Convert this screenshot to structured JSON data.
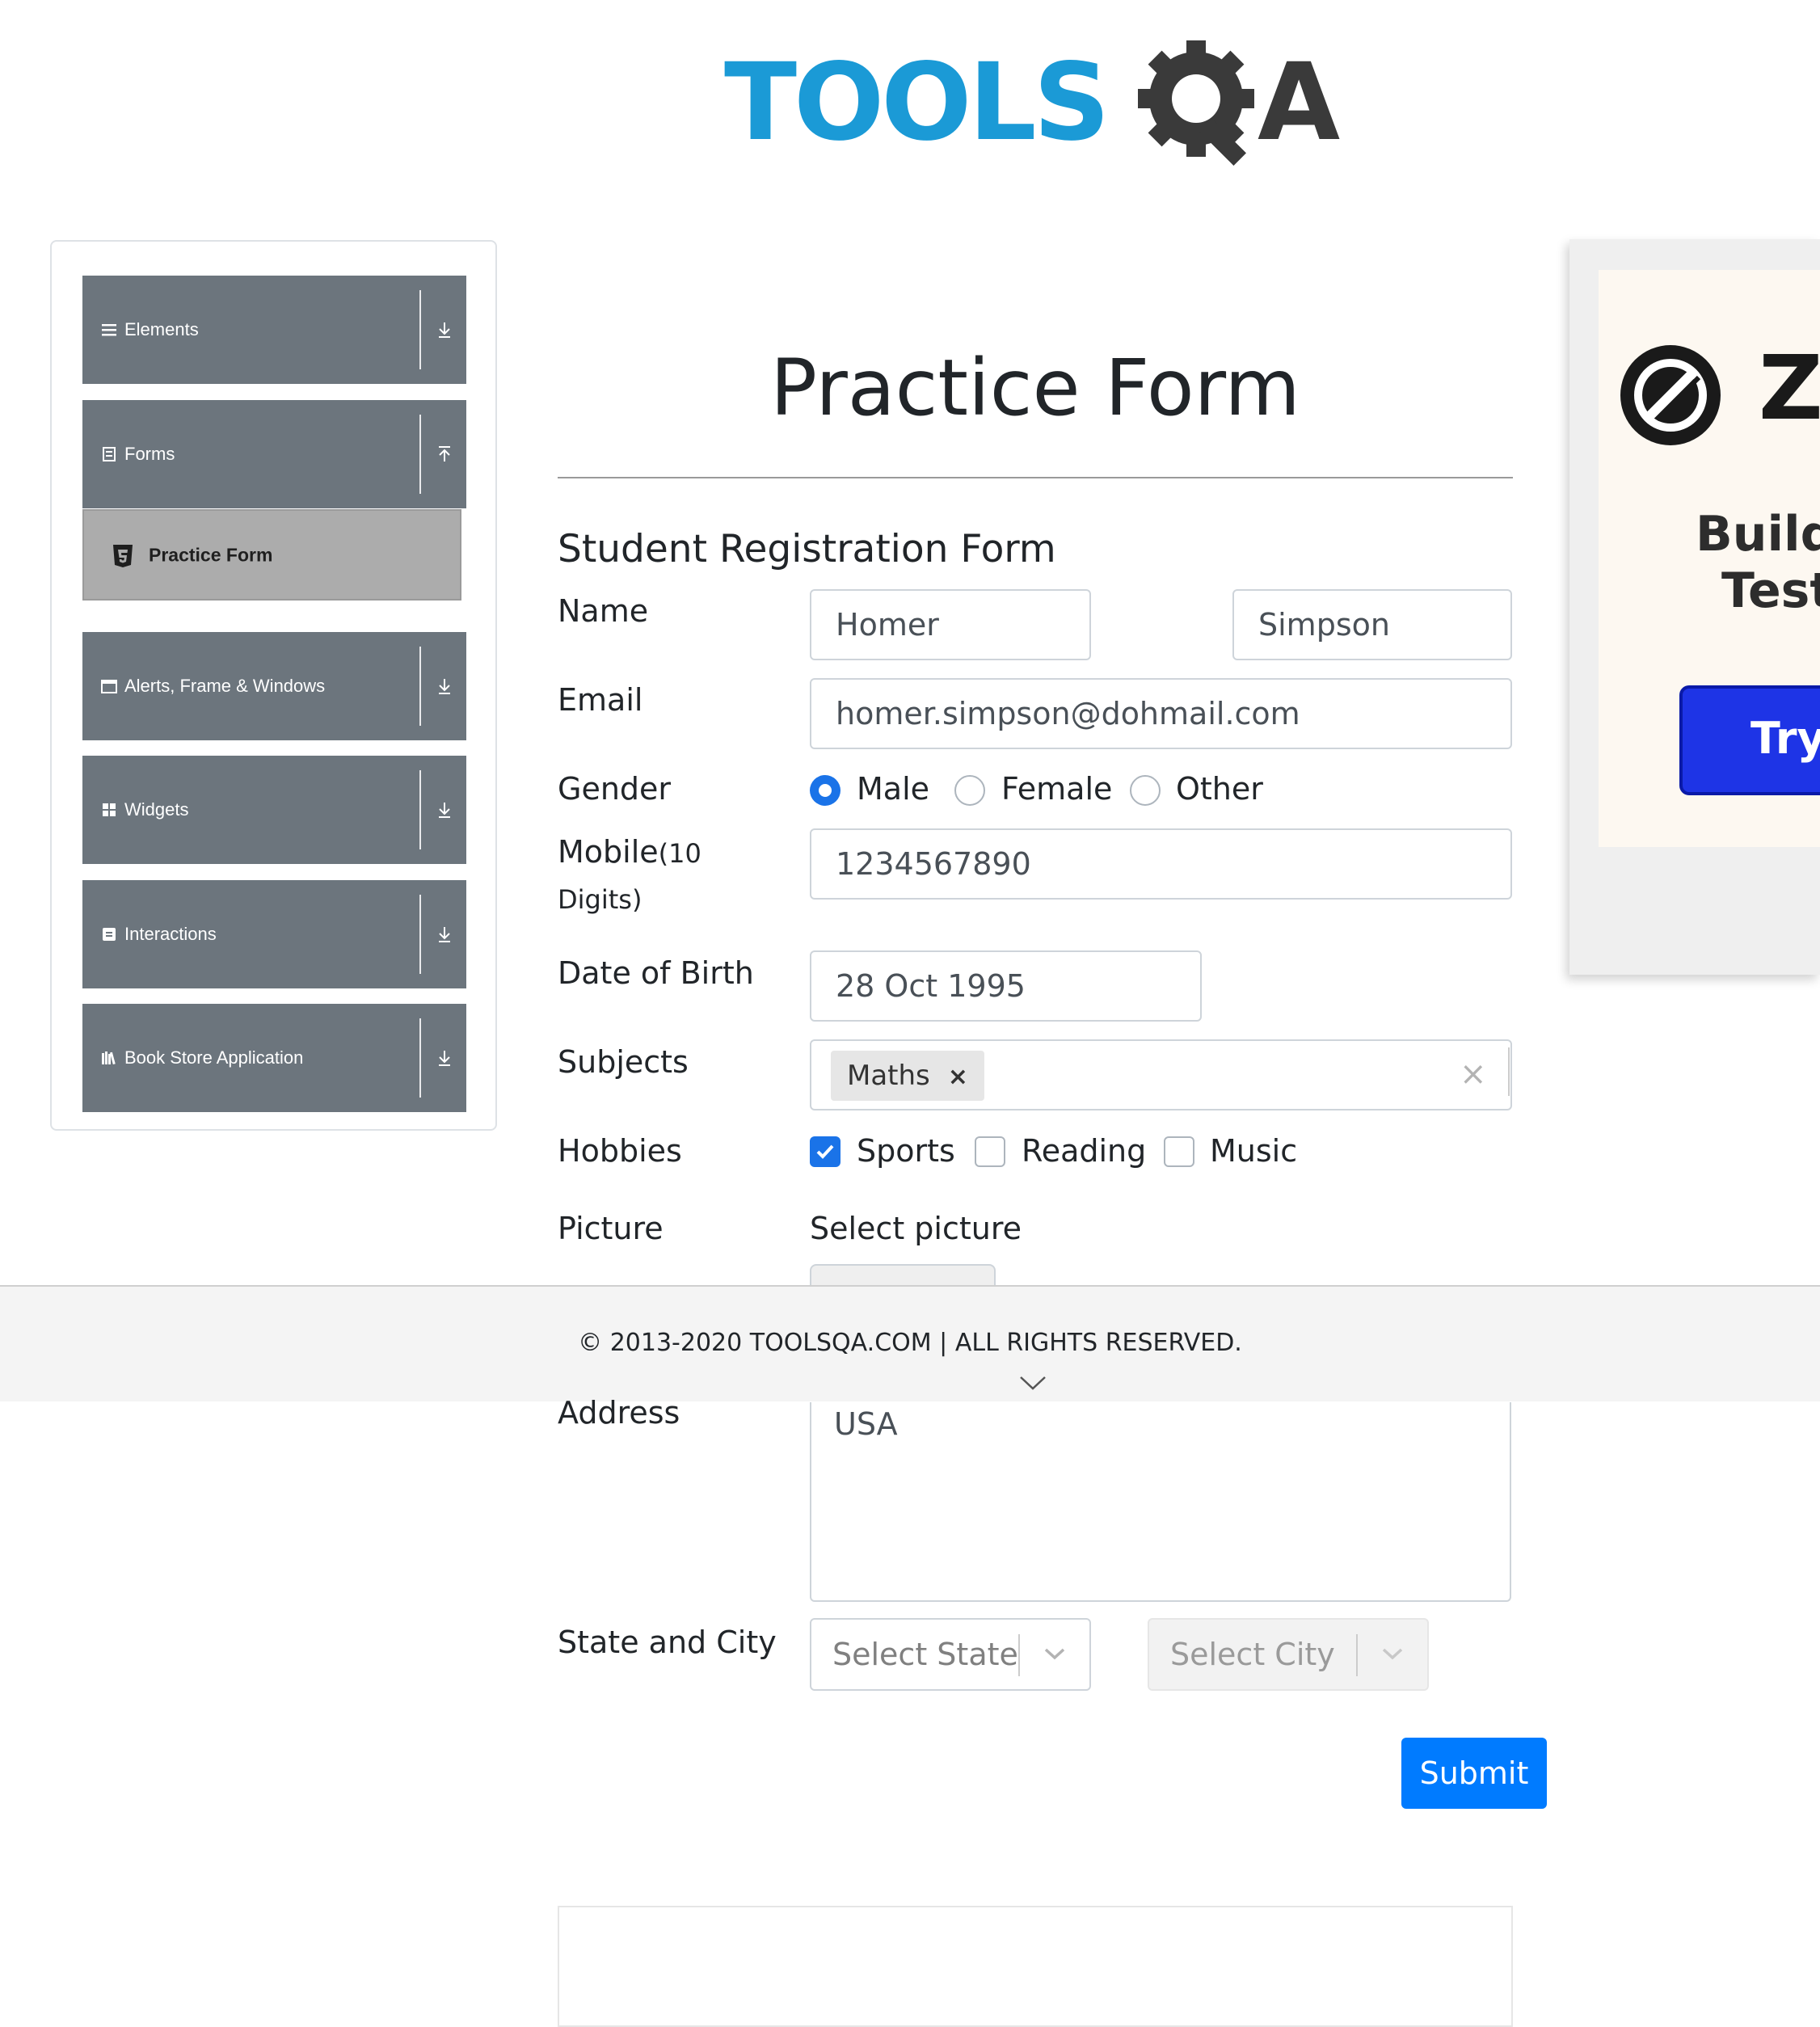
{
  "logo": {
    "part1": "TOOLS",
    "part2": "A",
    "brand_color": "#1b9ad6",
    "dark_color": "#3a3a3a"
  },
  "sidebar": {
    "groups": [
      {
        "label": "Elements",
        "icon": "hamburger-icon",
        "arrow": "download-arrow-icon"
      },
      {
        "label": "Forms",
        "icon": "document-icon",
        "arrow": "upload-arrow-icon"
      },
      {
        "label": "Alerts, Frame & Windows",
        "icon": "window-icon",
        "arrow": "download-arrow-icon"
      },
      {
        "label": "Widgets",
        "icon": "grid-icon",
        "arrow": "download-arrow-icon"
      },
      {
        "label": "Interactions",
        "icon": "interaction-icon",
        "arrow": "download-arrow-icon"
      },
      {
        "label": "Book Store Application",
        "icon": "books-icon",
        "arrow": "download-arrow-icon"
      }
    ],
    "active_item": {
      "label": "Practice Form",
      "icon": "html5-icon"
    }
  },
  "page": {
    "title": "Practice Form",
    "form_heading": "Student Registration Form"
  },
  "form": {
    "name_label": "Name",
    "first_name": "Homer",
    "last_name": "Simpson",
    "email_label": "Email",
    "email": "homer.simpson@dohmail.com",
    "gender_label": "Gender",
    "gender_options": [
      "Male",
      "Female",
      "Other"
    ],
    "gender_selected": "Male",
    "mobile_label": "Mobile",
    "mobile_hint_1": "(10",
    "mobile_hint_2": "Digits)",
    "mobile": "1234567890",
    "dob_label": "Date of Birth",
    "dob": "28 Oct 1995",
    "subjects_label": "Subjects",
    "subjects": [
      "Maths"
    ],
    "subjects_clear": "×",
    "hobbies_label": "Hobbies",
    "hobbies": [
      {
        "label": "Sports",
        "checked": true
      },
      {
        "label": "Reading",
        "checked": false
      },
      {
        "label": "Music",
        "checked": false
      }
    ],
    "picture_label": "Picture",
    "picture_prompt": "Select picture",
    "address_label": "Address",
    "address": "USA",
    "state_city_label": "State and City",
    "state_placeholder": "Select State",
    "city_placeholder": "Select City",
    "submit_label": "Submit"
  },
  "footer": {
    "text": "© 2013-2020 TOOLSQA.COM | ALL RIGHTS RESERVED."
  },
  "ad": {
    "letter": "Z",
    "line1": "Build",
    "line2": "Test",
    "button": "Try"
  },
  "colors": {
    "accent": "#007bff",
    "sidebar_bg": "#6c757d",
    "active_item_bg": "#acacac"
  }
}
